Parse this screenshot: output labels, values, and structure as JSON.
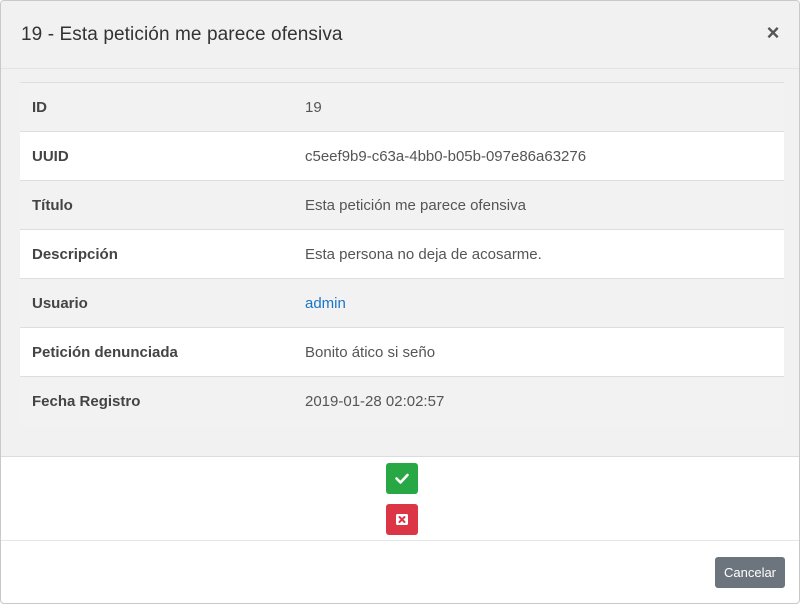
{
  "modal": {
    "title": "19 - Esta petición me parece ofensiva",
    "close_symbol": "×"
  },
  "details": [
    {
      "label": "ID",
      "value": "19"
    },
    {
      "label": "UUID",
      "value": "c5eef9b9-c63a-4bb0-b05b-097e86a63276"
    },
    {
      "label": "Título",
      "value": "Esta petición me parece ofensiva"
    },
    {
      "label": "Descripción",
      "value": "Esta persona no deja de acosarme."
    },
    {
      "label": "Usuario",
      "value": "admin"
    },
    {
      "label": "Petición denunciada",
      "value": "Bonito ático si seño"
    },
    {
      "label": "Fecha Registro",
      "value": "2019-01-28 02:02:57"
    }
  ],
  "actions": {
    "approve_icon": "check-icon",
    "reject_icon": "close-box-icon",
    "approve_color": "#28a745",
    "reject_color": "#dc3545"
  },
  "footer": {
    "cancel_label": "Cancelar"
  },
  "colors": {
    "link": "#1a75c7"
  }
}
